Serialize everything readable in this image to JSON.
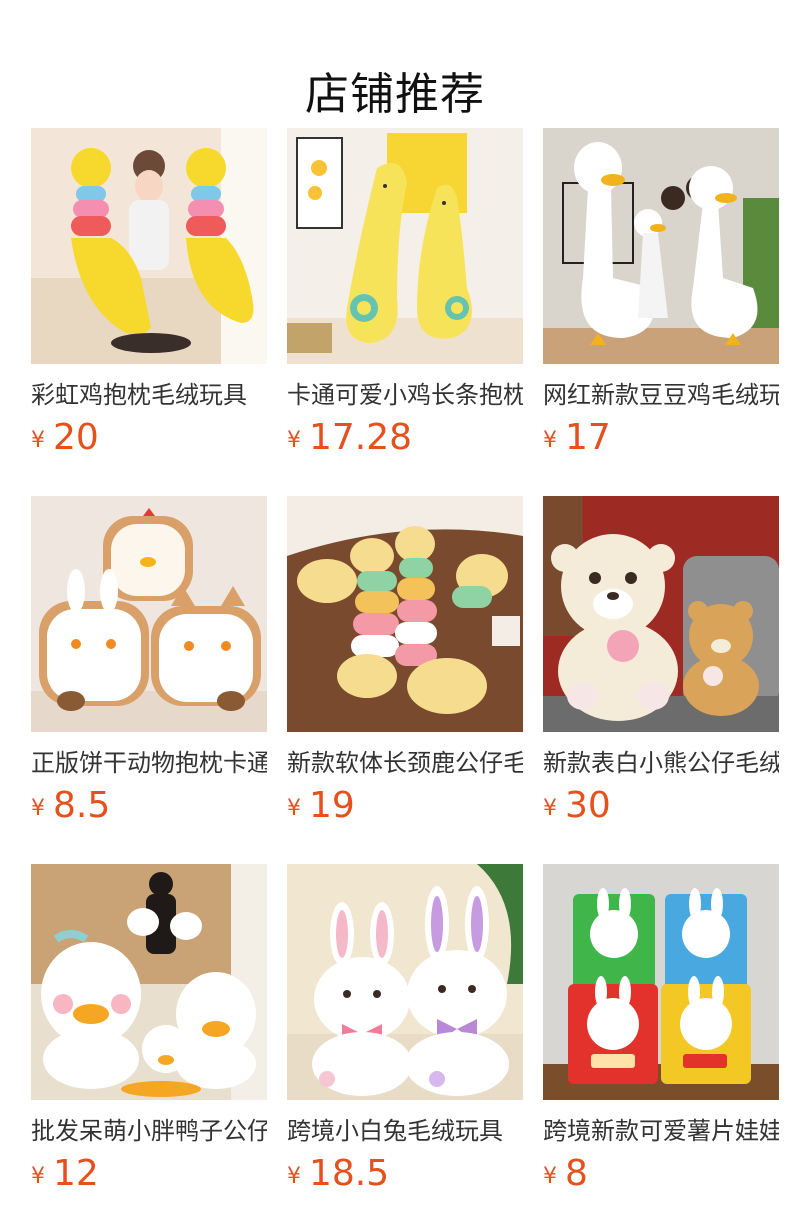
{
  "page": {
    "title": "店铺推荐"
  },
  "products": [
    {
      "name": "彩虹鸡抱枕毛绒玩具",
      "currency": "¥",
      "price": "20",
      "image": "rainbow-chicken-plush",
      "colors": {
        "bg": "#f3e6d8",
        "accent": "#f6d92c",
        "accent2": "#7fc8e8"
      }
    },
    {
      "name": "卡通可爱小鸡长条抱枕",
      "currency": "¥",
      "price": "17.28",
      "image": "long-chick-pillow",
      "colors": {
        "bg": "#f4efe9",
        "accent": "#f7e35a",
        "accent2": "#66c3b0"
      }
    },
    {
      "name": "网红新款豆豆鸡毛绒玩具",
      "currency": "¥",
      "price": "17",
      "image": "white-goose-plush",
      "colors": {
        "bg": "#d9d4cc",
        "accent": "#ffffff",
        "accent2": "#f2b21b"
      }
    },
    {
      "name": "正版饼干动物抱枕卡通",
      "currency": "¥",
      "price": "8.5",
      "image": "toast-animal-pillows",
      "colors": {
        "bg": "#efe7df",
        "accent": "#ffffff",
        "accent2": "#a86a3b"
      }
    },
    {
      "name": "新款软体长颈鹿公仔毛绒",
      "currency": "¥",
      "price": "19",
      "image": "soft-giraffe-plush",
      "colors": {
        "bg": "#7a4a2e",
        "accent": "#f6dc8e",
        "accent2": "#f39aa6"
      }
    },
    {
      "name": "新款表白小熊公仔毛绒",
      "currency": "¥",
      "price": "30",
      "image": "confession-bear-plush",
      "colors": {
        "bg": "#9e2a24",
        "accent": "#f4ecd9",
        "accent2": "#d9a35a"
      }
    },
    {
      "name": "批发呆萌小胖鸭子公仔",
      "currency": "¥",
      "price": "12",
      "image": "chubby-duck-plush",
      "colors": {
        "bg": "#e9dfcf",
        "accent": "#ffffff",
        "accent2": "#f5a623"
      }
    },
    {
      "name": "跨境小白兔毛绒玩具",
      "currency": "¥",
      "price": "18.5",
      "image": "white-rabbit-plush",
      "colors": {
        "bg": "#f1e6cf",
        "accent": "#ffffff",
        "accent2": "#b889d6"
      }
    },
    {
      "name": "跨境新款可爱薯片娃娃",
      "currency": "¥",
      "price": "8",
      "image": "chip-bag-rabbit-plush",
      "colors": {
        "bg": "#d8d6d2",
        "accent": "#ffffff",
        "accent2": "#e3312c"
      }
    }
  ]
}
